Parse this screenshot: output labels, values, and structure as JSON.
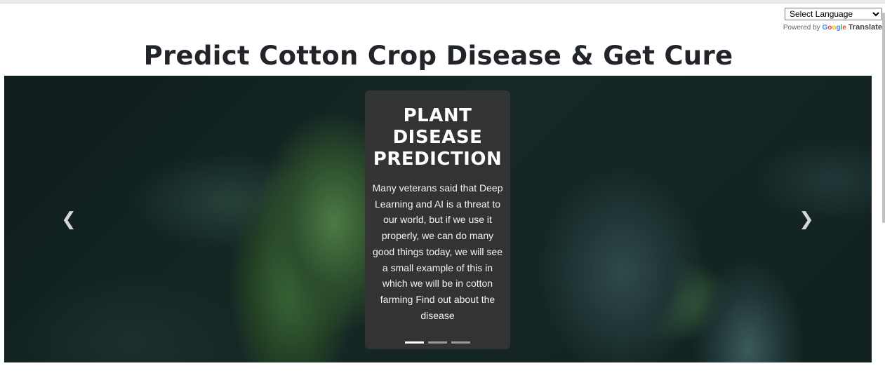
{
  "translate": {
    "select_value": "Select Language",
    "powered_by": "Powered by",
    "google": "Google",
    "translate": "Translate"
  },
  "page": {
    "title": "Predict Cotton Crop Disease & Get Cure"
  },
  "carousel": {
    "prev_icon": "chevron-left-icon",
    "next_icon": "chevron-right-icon",
    "prev_glyph": "❮",
    "next_glyph": "❯",
    "slide_title": "PLANT DISEASE PREDICTION",
    "slide_text": "Many veterans said that Deep Learning and AI is a threat to our world, but if we use it properly, we can do many good things today, we will see a small example of this in which we will be in cotton farming Find out about the disease",
    "slide_count": 3,
    "active_slide": 1
  },
  "colors": {
    "google_blue": "#4285F4",
    "google_red": "#EA4335",
    "google_yellow": "#FBBC05",
    "google_green": "#34A853"
  }
}
